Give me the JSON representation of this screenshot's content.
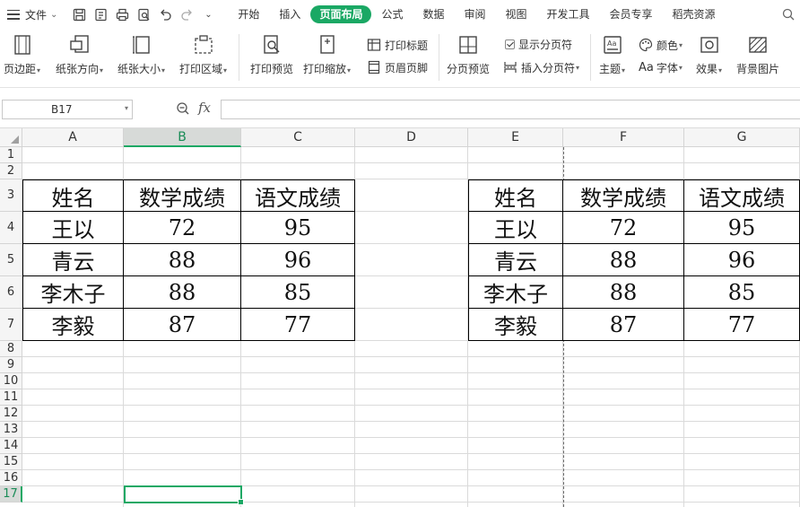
{
  "menubar": {
    "file_label": "文件",
    "tabs": [
      "开始",
      "插入",
      "页面布局",
      "公式",
      "数据",
      "审阅",
      "视图",
      "开发工具",
      "会员专享",
      "稻壳资源"
    ],
    "active_tab": "页面布局"
  },
  "ribbon": {
    "margins": "页边距",
    "orientation": "纸张方向",
    "size": "纸张大小",
    "print_area": "打印区域",
    "print_preview": "打印预览",
    "print_scale": "打印缩放",
    "print_titles": "打印标题",
    "header_footer": "页眉页脚",
    "page_break_preview": "分页预览",
    "show_page_breaks": "显示分页符",
    "insert_page_break": "插入分页符",
    "theme": "主题",
    "colors": "颜色",
    "fonts": "字体",
    "fonts_prefix": "Aa",
    "effects": "效果",
    "background": "背景图片"
  },
  "formula_bar": {
    "name_box": "B17",
    "fx": "fx",
    "formula": ""
  },
  "sheet": {
    "columns": [
      "A",
      "B",
      "C",
      "D",
      "E",
      "F",
      "G"
    ],
    "selected_column": "B",
    "rows": [
      "1",
      "2",
      "3",
      "4",
      "5",
      "6",
      "7",
      "8",
      "9",
      "10",
      "11",
      "12",
      "13",
      "14",
      "15",
      "16",
      "17"
    ],
    "selected_row": "17",
    "table_left": [
      [
        "姓名",
        "数学成绩",
        "语文成绩"
      ],
      [
        "王以",
        "72",
        "95"
      ],
      [
        "青云",
        "88",
        "96"
      ],
      [
        "李木子",
        "88",
        "85"
      ],
      [
        "李毅",
        "87",
        "77"
      ]
    ],
    "table_right": [
      [
        "姓名",
        "数学成绩",
        "语文成绩"
      ],
      [
        "王以",
        "72",
        "95"
      ],
      [
        "青云",
        "88",
        "96"
      ],
      [
        "李木子",
        "88",
        "85"
      ],
      [
        "李毅",
        "87",
        "77"
      ]
    ]
  },
  "colors": {
    "accent": "#1aa864"
  }
}
